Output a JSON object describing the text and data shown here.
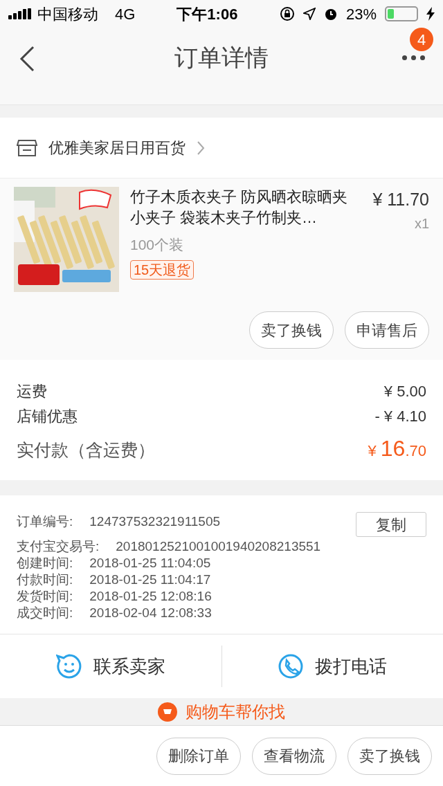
{
  "status_bar": {
    "carrier": "中国移动",
    "network": "4G",
    "time": "下午1:06",
    "battery": "23%"
  },
  "nav": {
    "title": "订单详情",
    "badge": "4"
  },
  "shop": {
    "name": "优雅美家居日用百货"
  },
  "product": {
    "kind": "picture",
    "title": "竹子木质衣夹子 防风晒衣晾晒夹小夹子 袋装木夹子竹制夹…",
    "price": "¥ 11.70",
    "quantity": "x1",
    "spec": "100个装",
    "tag": "15天退货",
    "actions": [
      "卖了换钱",
      "申请售后"
    ]
  },
  "fees": [
    {
      "label": "运费",
      "value": "¥ 5.00"
    },
    {
      "label": "店铺优惠",
      "value": "- ¥ 4.10"
    }
  ],
  "total": {
    "label": "实付款（含运费）",
    "currency": "¥ ",
    "integer": "16",
    "decimals": ".70"
  },
  "order_info": {
    "copy_button": "复制",
    "rows": [
      {
        "label": "订单编号:",
        "value": "124737532321911505"
      },
      {
        "label": "支付宝交易号:",
        "value": "2018012521001001940208213551"
      },
      {
        "label": "创建时间:",
        "value": "2018-01-25 11:04:05"
      },
      {
        "label": "付款时间:",
        "value": "2018-01-25 11:04:17"
      },
      {
        "label": "发货时间:",
        "value": "2018-01-25 12:08:16"
      },
      {
        "label": "成交时间:",
        "value": "2018-02-04 12:08:33"
      }
    ]
  },
  "contact": [
    {
      "kind": "chat",
      "label": "联系卖家"
    },
    {
      "kind": "phone",
      "label": "拨打电话"
    }
  ],
  "promo": {
    "text": "购物车帮你找"
  },
  "bottom_actions": [
    "删除订单",
    "查看物流",
    "卖了换钱"
  ]
}
